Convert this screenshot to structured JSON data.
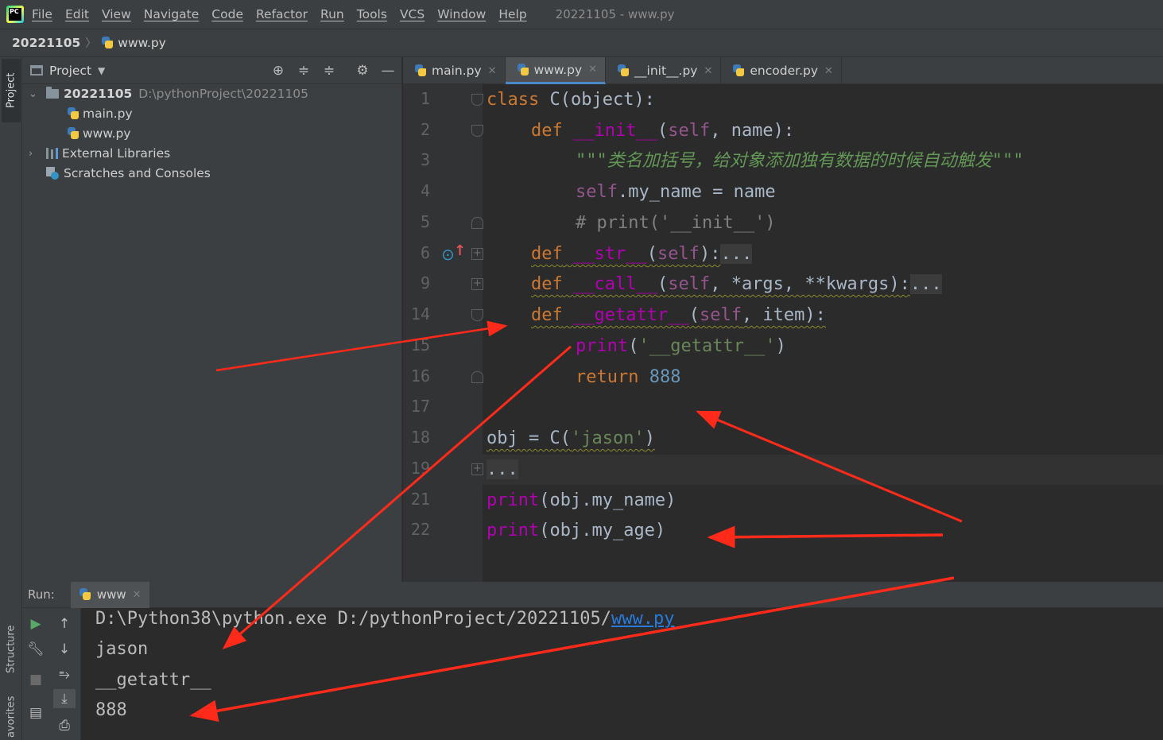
{
  "menubar": {
    "logo_text": "PC",
    "items": [
      "File",
      "Edit",
      "View",
      "Navigate",
      "Code",
      "Refactor",
      "Run",
      "Tools",
      "VCS",
      "Window",
      "Help"
    ],
    "window_title": "20221105 - www.py"
  },
  "navbar": {
    "project": "20221105",
    "file": "www.py"
  },
  "left_strip": {
    "project_tab": "Project",
    "structure_tab": "Structure",
    "favorites_tab": "avorites"
  },
  "project_panel": {
    "title": "Project",
    "tree": {
      "root_name": "20221105",
      "root_path": "D:\\pythonProject\\20221105",
      "files": [
        "main.py",
        "www.py"
      ],
      "external_libraries": "External Libraries",
      "scratches": "Scratches and Consoles"
    }
  },
  "editor": {
    "tabs": [
      {
        "label": "main.py"
      },
      {
        "label": "www.py"
      },
      {
        "label": "__init__.py"
      },
      {
        "label": "encoder.py"
      }
    ],
    "line_numbers": [
      "1",
      "2",
      "3",
      "4",
      "5",
      "6",
      "9",
      "14",
      "15",
      "16",
      "17",
      "18",
      "19",
      "21",
      "22"
    ],
    "code": {
      "l1_kw": "class",
      "l1_rest": " C(object):",
      "l2_kw": "def",
      "l2_name": "__init__",
      "l2_open": "(",
      "l2_self": "self",
      "l2_rest": ", name):",
      "l3_doc": "\"\"\"类名加括号，给对象添加独有数据的时候自动触发\"\"\"",
      "l4_self": "self",
      "l4_rest": ".my_name = name",
      "l5_comment": "# print('__init__')",
      "l6_kw": "def",
      "l6_name": "__str__",
      "l6_open": "(",
      "l6_self": "self",
      "l6_rest": "):",
      "l6_dots": "...",
      "l9_kw": "def",
      "l9_name": "__call__",
      "l9_open": "(",
      "l9_self": "self",
      "l9_rest": ", *args, **kwargs):",
      "l9_dots": "...",
      "l14_kw": "def",
      "l14_name": "__getattr__",
      "l14_open": "(",
      "l14_self": "self",
      "l14_rest": ", item):",
      "l15_fn": "print",
      "l15_open": "(",
      "l15_str": "'__getattr__'",
      "l15_close": ")",
      "l16_kw": "return",
      "l16_num": "888",
      "l18_a": "obj = C(",
      "l18_str": "'jason'",
      "l18_b": ")",
      "l19_dots": "...",
      "l21_fn": "print",
      "l21_rest": "(obj.my_name)",
      "l22_fn": "print",
      "l22_rest": "(obj.my_age)"
    }
  },
  "run_panel": {
    "label": "Run:",
    "tab": "www",
    "output": {
      "cmd_prefix": "D:\\Python38\\python.exe D:/pythonProject/20221105/",
      "cmd_link": "www.py",
      "lines": [
        "jason",
        "__getattr__",
        "888"
      ]
    }
  },
  "colors": {
    "annotation_arrow": "#ff2a1a",
    "keyword": "#cc7832",
    "string": "#6a8759",
    "number": "#6897bb",
    "magic": "#b200b2"
  }
}
